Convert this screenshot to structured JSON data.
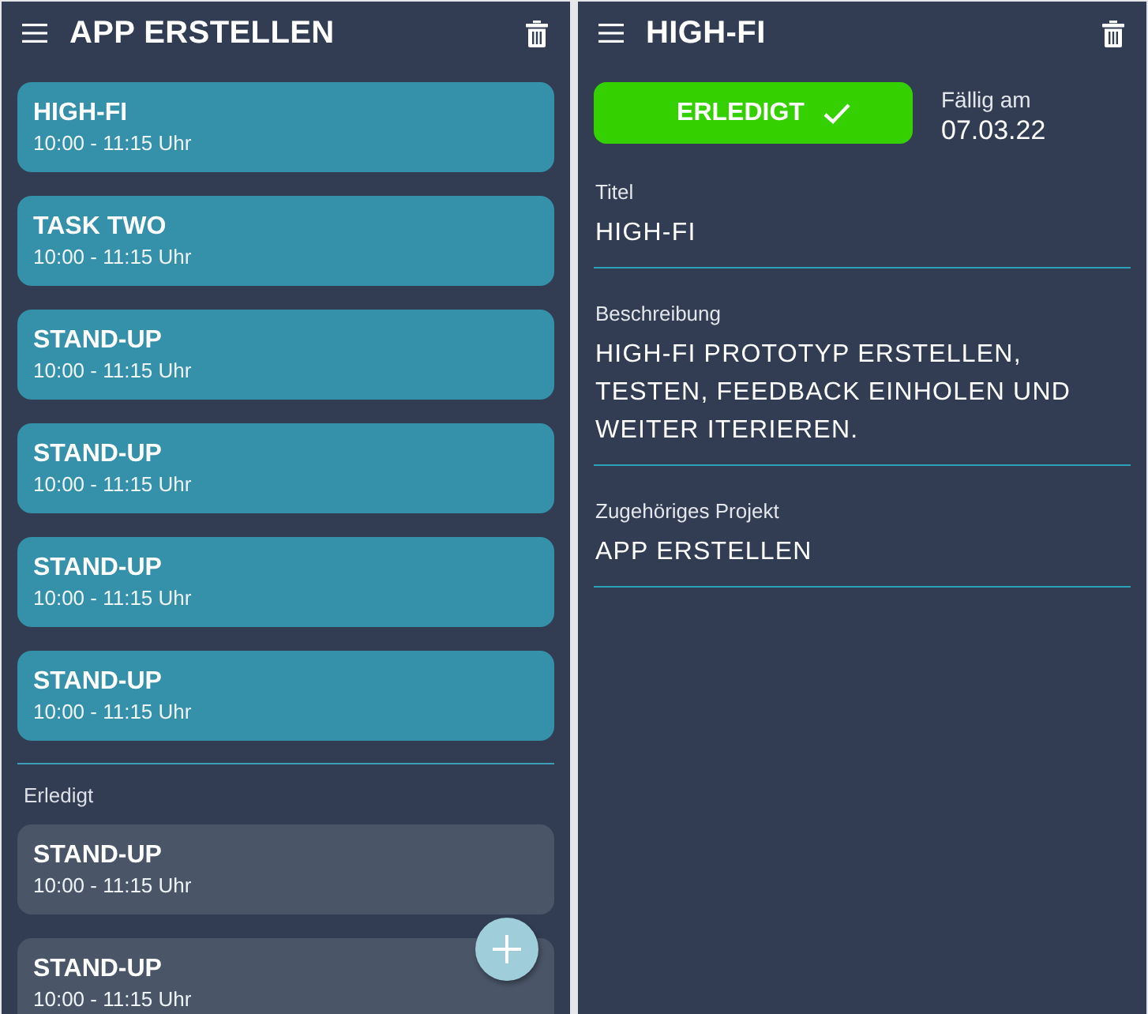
{
  "list_screen": {
    "title": "APP ERSTELLEN",
    "open_tasks": [
      {
        "title": "HIGH-FI",
        "time": "10:00 - 11:15 Uhr"
      },
      {
        "title": "TASK TWO",
        "time": "10:00 - 11:15 Uhr"
      },
      {
        "title": "STAND-UP",
        "time": "10:00 - 11:15 Uhr"
      },
      {
        "title": "STAND-UP",
        "time": "10:00 - 11:15 Uhr"
      },
      {
        "title": "STAND-UP",
        "time": "10:00 - 11:15 Uhr"
      },
      {
        "title": "STAND-UP",
        "time": "10:00 - 11:15 Uhr"
      }
    ],
    "done_heading": "Erledigt",
    "done_tasks": [
      {
        "title": "STAND-UP",
        "time": "10:00 - 11:15 Uhr"
      },
      {
        "title": "STAND-UP",
        "time": "10:00 - 11:15 Uhr"
      }
    ]
  },
  "detail_screen": {
    "title": "HIGH-FI",
    "status_button": {
      "label": "ERLEDIGT",
      "done": true
    },
    "due": {
      "label": "Fällig am",
      "value": "07.03.22"
    },
    "fields": [
      {
        "label": "Titel",
        "value": "HIGH-FI"
      },
      {
        "label": "Beschreibung",
        "value": "HIGH-FI PROTOTYP ERSTELLEN, TESTEN, FEEDBACK EINHOLEN UND WEITER ITERIEREN."
      },
      {
        "label": "Zugehöriges Projekt",
        "value": "APP ERSTELLEN"
      }
    ]
  }
}
